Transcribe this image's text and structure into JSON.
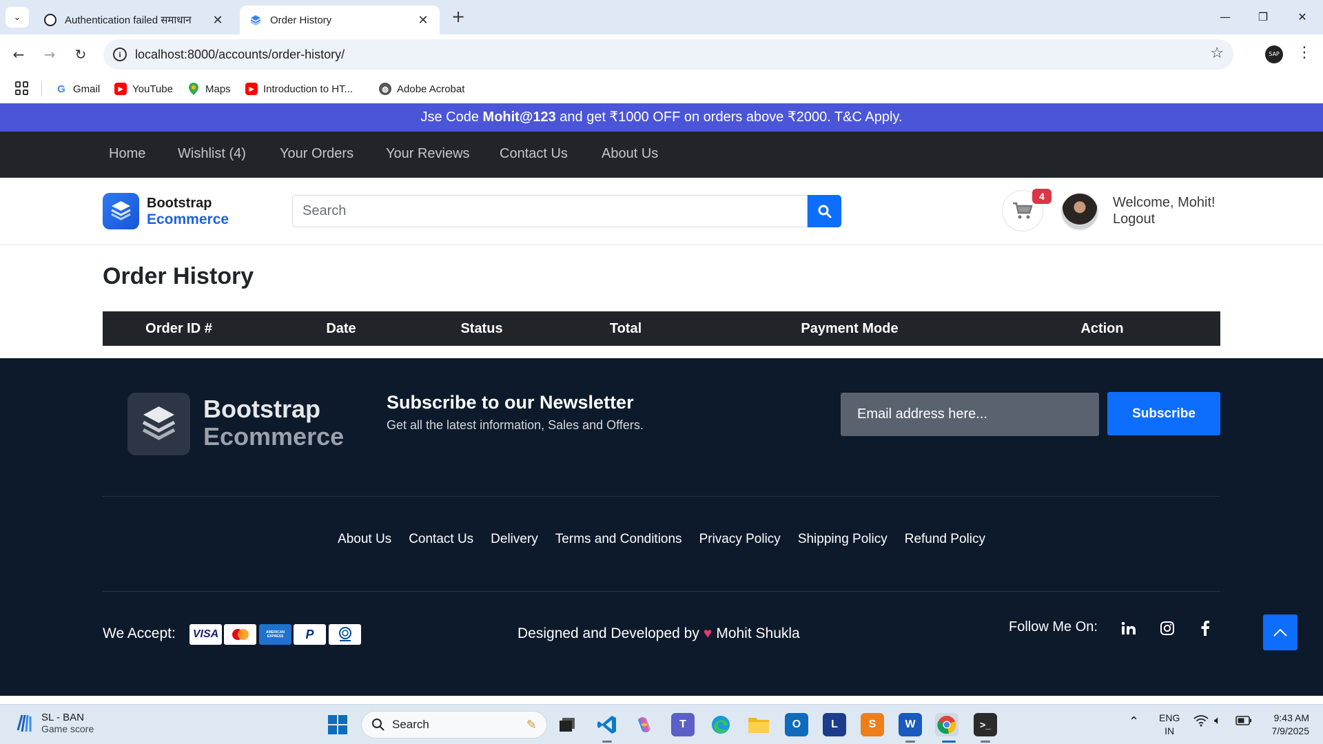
{
  "browser": {
    "tabs": [
      {
        "title": "Authentication failed समाधान",
        "active": false
      },
      {
        "title": "Order History",
        "active": true
      }
    ],
    "url": "localhost:8000/accounts/order-history/",
    "bookmarks": [
      {
        "label": "Gmail",
        "icon": "google-icon"
      },
      {
        "label": "YouTube",
        "icon": "youtube-icon"
      },
      {
        "label": "Maps",
        "icon": "maps-pin-icon"
      },
      {
        "label": "Introduction to HT...",
        "icon": "youtube-icon"
      },
      {
        "label": "Adobe Acrobat",
        "icon": "acrobat-globe-icon"
      }
    ],
    "profile_badge": "SAP"
  },
  "promo": {
    "prefix": "Jse Code ",
    "code": "Mohit@123",
    "suffix": " and get ₹1000 OFF on orders above ₹2000. T&C Apply."
  },
  "nav": {
    "items": [
      "Home",
      "Wishlist (4)",
      "Your Orders",
      "Your Reviews",
      "Contact Us",
      "About Us"
    ]
  },
  "header": {
    "logo_line1": "Bootstrap",
    "logo_line2": "Ecommerce",
    "search_placeholder": "Search",
    "cart_count": "4",
    "welcome": "Welcome, Mohit!",
    "logout": "Logout"
  },
  "main": {
    "title": "Order History",
    "columns": [
      "Order ID #",
      "Date",
      "Status",
      "Total",
      "Payment Mode",
      "Action"
    ]
  },
  "footer": {
    "logo_line1": "Bootstrap",
    "logo_line2": "Ecommerce",
    "newsletter_title": "Subscribe to our Newsletter",
    "newsletter_sub": "Get all the latest information, Sales and Offers.",
    "email_placeholder": "Email address here...",
    "subscribe": "Subscribe",
    "links": [
      "About Us",
      "Contact Us",
      "Delivery",
      "Terms and Conditions",
      "Privacy Policy",
      "Shipping Policy",
      "Refund Policy"
    ],
    "we_accept": "We Accept:",
    "payment_cards": [
      "VISA",
      "Mastercard",
      "AMERICAN EXPRESS",
      "PayPal",
      "Diners Club"
    ],
    "credit_prefix": "Designed and Developed by",
    "credit_name": "Mohit Shukla",
    "follow": "Follow Me On:",
    "socials": [
      "linkedin-icon",
      "instagram-icon",
      "facebook-icon"
    ]
  },
  "taskbar": {
    "widget_title": "SL - BAN",
    "widget_sub": "Game score",
    "search": "Search",
    "lang_1": "ENG",
    "lang_2": "IN",
    "time": "9:43 AM",
    "date": "7/9/2025"
  },
  "colors": {
    "promo_bg": "#4b55d8",
    "nav_bg": "#212529",
    "primary": "#0d6efd",
    "footer_bg": "#0d1a2b",
    "badge": "#dc3545"
  }
}
